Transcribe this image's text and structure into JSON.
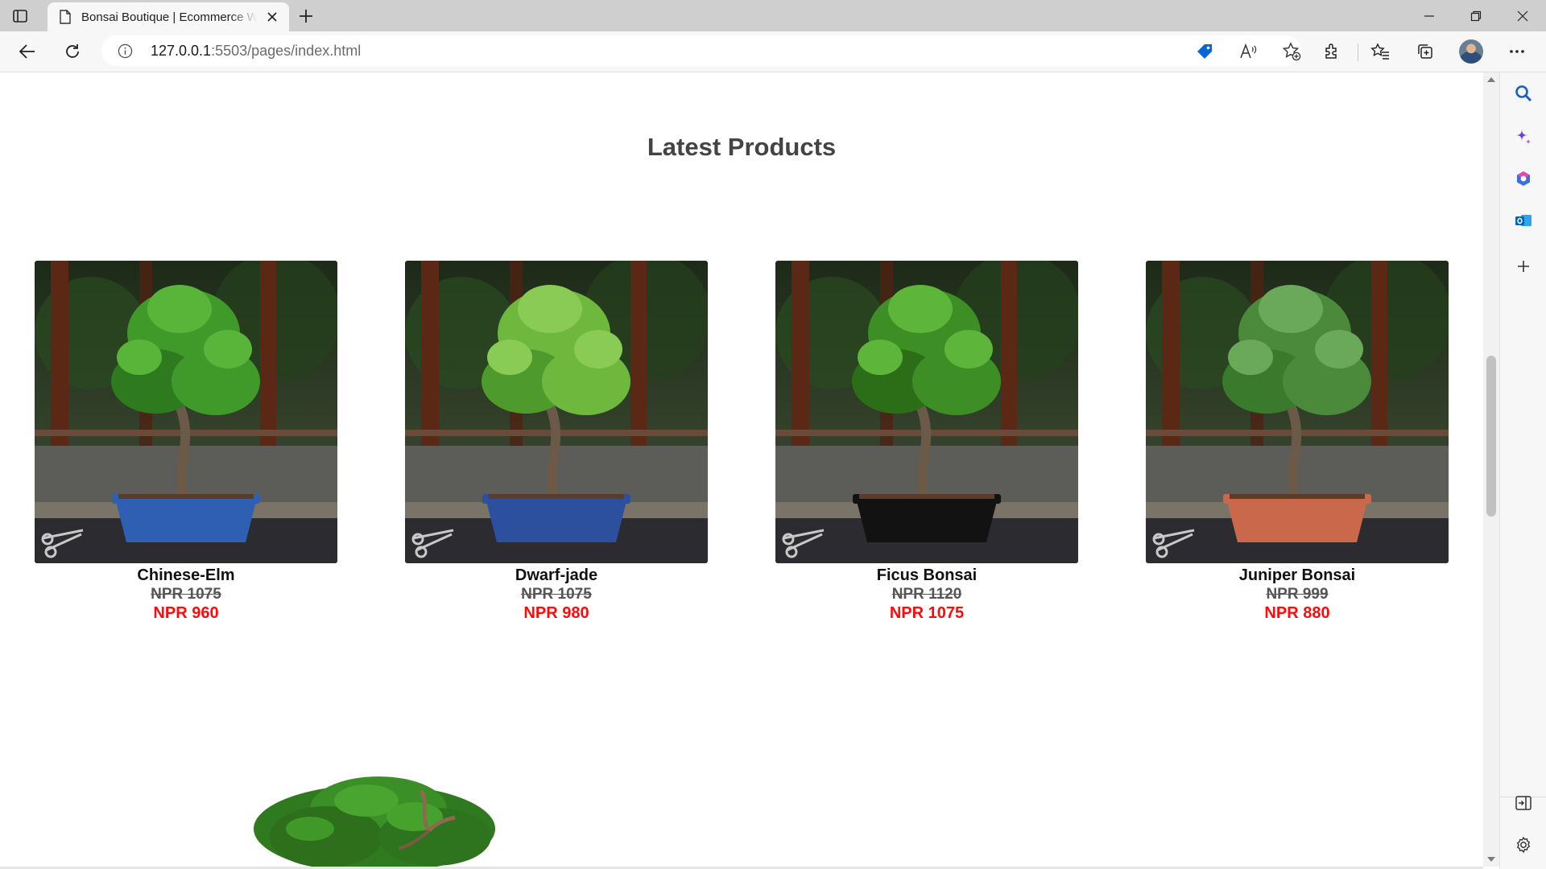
{
  "browser": {
    "tab_title": "Bonsai Boutique | Ecommerce Website",
    "url_host": "127.0.0.1",
    "url_rest": ":5503/pages/index.html"
  },
  "page": {
    "section_title": "Latest Products",
    "products": [
      {
        "name": "Chinese-Elm",
        "old_price": "NPR 1075",
        "new_price": "NPR 960",
        "pot_color": "#2f5fb3"
      },
      {
        "name": "Dwarf-jade",
        "old_price": "NPR 1075",
        "new_price": "NPR 980",
        "pot_color": "#2c4f9e"
      },
      {
        "name": "Ficus Bonsai",
        "old_price": "NPR 1120",
        "new_price": "NPR 1075",
        "pot_color": "#121212"
      },
      {
        "name": "Juniper Bonsai",
        "old_price": "NPR 999",
        "new_price": "NPR 880",
        "pot_color": "#c9684a"
      }
    ]
  },
  "colors": {
    "sale_price": "#ff0a0a",
    "title": "#444444",
    "edge_accent": "#0a66d8"
  },
  "icons": [
    "tab-actions-icon",
    "page-icon",
    "close-icon",
    "plus-icon",
    "minimize-icon",
    "restore-icon",
    "back-icon",
    "refresh-icon",
    "info-icon",
    "tag-icon",
    "read-aloud-icon",
    "favorite-add-icon",
    "extensions-icon",
    "favorites-icon",
    "collections-icon",
    "more-icon",
    "search-icon",
    "copilot-icon",
    "microsoft365-icon",
    "outlook-icon",
    "sidebar-hide-icon",
    "settings-icon"
  ]
}
